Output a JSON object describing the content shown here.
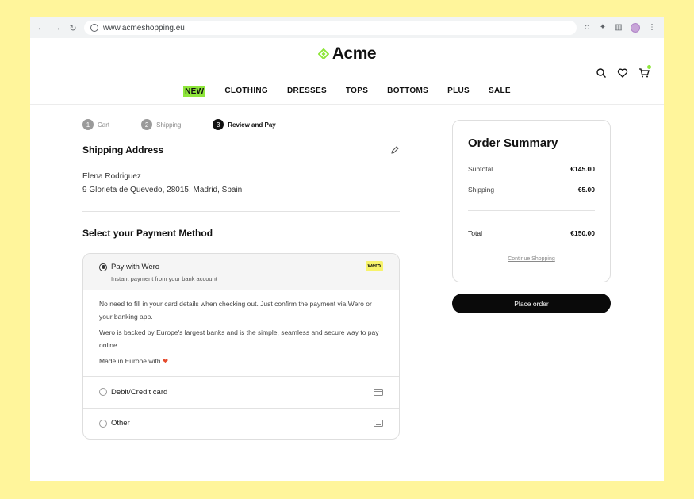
{
  "browser": {
    "url": "www.acmeshopping.eu"
  },
  "site": {
    "logo_text": "Acme",
    "nav": [
      "NEW",
      "CLOTHING",
      "DRESSES",
      "TOPS",
      "BOTTOMS",
      "PLUS",
      "SALE"
    ],
    "accent_color": "#8ee63b"
  },
  "stepper": [
    {
      "num": "1",
      "label": "Cart"
    },
    {
      "num": "2",
      "label": "Shipping"
    },
    {
      "num": "3",
      "label": "Review and Pay"
    }
  ],
  "shipping": {
    "title": "Shipping Address",
    "name": "Elena Rodriguez",
    "address": "9 Glorieta de Quevedo, 28015, Madrid, Spain"
  },
  "payment": {
    "title": "Select your Payment Method",
    "wero": {
      "label": "Pay with Wero",
      "sub": "Instant payment from your bank account",
      "badge": "wero",
      "desc1": "No need to fill in your card details when checking out. Just confirm the payment via Wero or your banking app.",
      "desc2": "Wero is backed by Europe's largest banks and is the simple, seamless and secure way to pay online.",
      "desc3": "Made in Europe with",
      "heart": "❤"
    },
    "card_label": "Debit/Credit card",
    "other_label": "Other"
  },
  "summary": {
    "title": "Order Summary",
    "subtotal_label": "Subtotal",
    "subtotal_value": "€145.00",
    "shipping_label": "Shipping",
    "shipping_value": "€5.00",
    "total_label": "Total",
    "total_value": "€150.00",
    "continue": "Continue Shopping",
    "place_order": "Place order"
  }
}
